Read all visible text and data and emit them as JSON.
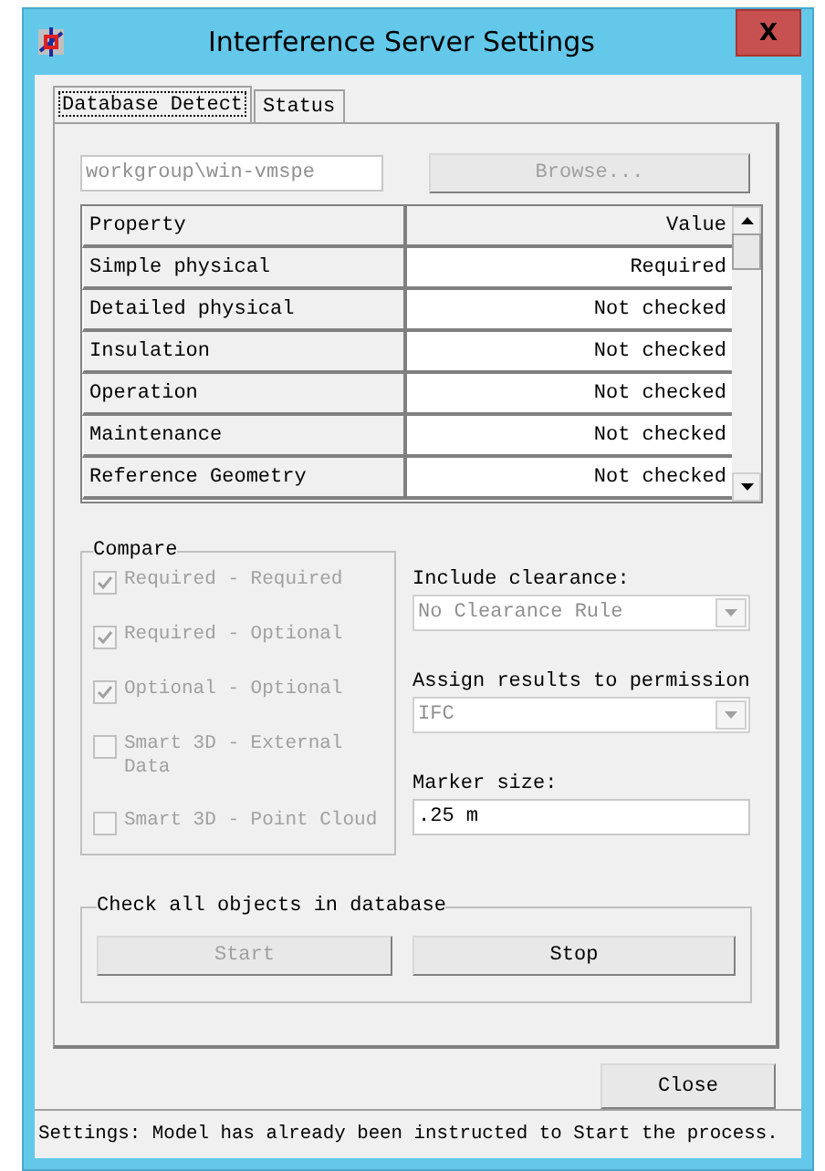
{
  "window": {
    "title": "Interference Server Settings",
    "close": "X"
  },
  "tabs": [
    {
      "label": "Database Detect",
      "selected": true
    },
    {
      "label": "Status",
      "selected": false
    }
  ],
  "path_field": {
    "value": "workgroup\\win-vmspe",
    "disabled": true
  },
  "browse_button": {
    "label": "Browse...",
    "disabled": true
  },
  "table": {
    "columns": [
      "Property",
      "Value"
    ],
    "rows": [
      {
        "property": "Simple physical",
        "value": "Required"
      },
      {
        "property": "Detailed physical",
        "value": "Not checked"
      },
      {
        "property": "Insulation",
        "value": "Not checked"
      },
      {
        "property": "Operation",
        "value": "Not checked"
      },
      {
        "property": "Maintenance",
        "value": "Not checked"
      },
      {
        "property": "Reference Geometry",
        "value": "Not checked"
      }
    ]
  },
  "compare": {
    "title": "Compare",
    "options": [
      {
        "label": "Required - Required",
        "checked": true,
        "disabled": true
      },
      {
        "label": "Required - Optional",
        "checked": true,
        "disabled": true
      },
      {
        "label": "Optional - Optional",
        "checked": true,
        "disabled": true
      },
      {
        "label": "Smart 3D - External Data",
        "checked": false,
        "disabled": true
      },
      {
        "label": "Smart 3D - Point Cloud",
        "checked": false,
        "disabled": true
      }
    ]
  },
  "include_clearance": {
    "label": "Include clearance:",
    "value": "No Clearance Rule",
    "disabled": true
  },
  "assign_permission": {
    "label": "Assign results to permission",
    "value": "IFC",
    "disabled": true
  },
  "marker_size": {
    "label": "Marker size:",
    "value": ".25 m"
  },
  "check_all": {
    "title": "Check all objects in database",
    "buttons": [
      {
        "label": "Start",
        "disabled": true
      },
      {
        "label": "Stop",
        "disabled": false
      }
    ]
  },
  "close_button": {
    "label": "Close"
  },
  "status_bar": "Settings: Model has already been instructed to Start the process."
}
